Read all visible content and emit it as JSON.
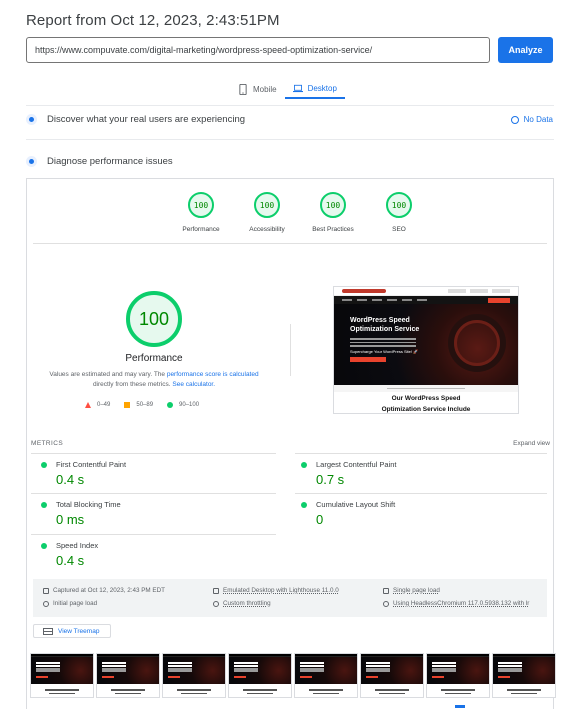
{
  "header": {
    "title": "Report from Oct 12, 2023, 2:43:51PM",
    "url_value": "https://www.compuvate.com/digital-marketing/wordpress-speed-optimization-service/",
    "analyze_label": "Analyze"
  },
  "device_tabs": [
    {
      "label": "Mobile",
      "active": false,
      "icon": "phone-icon"
    },
    {
      "label": "Desktop",
      "active": true,
      "icon": "laptop-icon"
    }
  ],
  "sections": {
    "discover": "Discover what your real users are experiencing",
    "no_data": "No Data",
    "diagnose": "Diagnose performance issues"
  },
  "gauges": [
    {
      "score": "100",
      "label": "Performance"
    },
    {
      "score": "100",
      "label": "Accessibility"
    },
    {
      "score": "100",
      "label": "Best Practices"
    },
    {
      "score": "100",
      "label": "SEO"
    }
  ],
  "performance": {
    "score": "100",
    "title": "Performance",
    "note_prefix": "Values are estimated and may vary. The ",
    "note_link1": "performance score is calculated",
    "note_mid": " directly from these metrics. ",
    "note_link2": "See calculator.",
    "legend": [
      "0–49",
      "50–89",
      "90–100"
    ]
  },
  "screenshot": {
    "hero_title_1": "WordPress Speed",
    "hero_title_2": "Optimization Service",
    "hero_tagline": "Supercharge Your WordPress Site! 🚀",
    "sub_1": "Our WordPress Speed",
    "sub_2": "Optimization Service Include"
  },
  "metrics": {
    "heading": "METRICS",
    "expand": "Expand view",
    "items": [
      {
        "name": "First Contentful Paint",
        "value": "0.4 s"
      },
      {
        "name": "Largest Contentful Paint",
        "value": "0.7 s"
      },
      {
        "name": "Total Blocking Time",
        "value": "0 ms"
      },
      {
        "name": "Cumulative Layout Shift",
        "value": "0"
      },
      {
        "name": "Speed Index",
        "value": "0.4 s"
      }
    ]
  },
  "environment": {
    "captured": "Captured at Oct 12, 2023, 2:43 PM EDT",
    "initial_load": "Initial page load",
    "emulated": "Emulated Desktop with Lighthouse 11.0.0",
    "throttling": "Custom throttling",
    "single_load": "Single page load",
    "browser": "Using HeadlessChromium 117.0.5938.132 with lr"
  },
  "treemap_label": "View Treemap",
  "colors": {
    "accent": "#1a73e8",
    "pass": "#0cce6b",
    "pass_text": "#008800",
    "average": "#ffa400",
    "fail": "#ff4e42"
  }
}
